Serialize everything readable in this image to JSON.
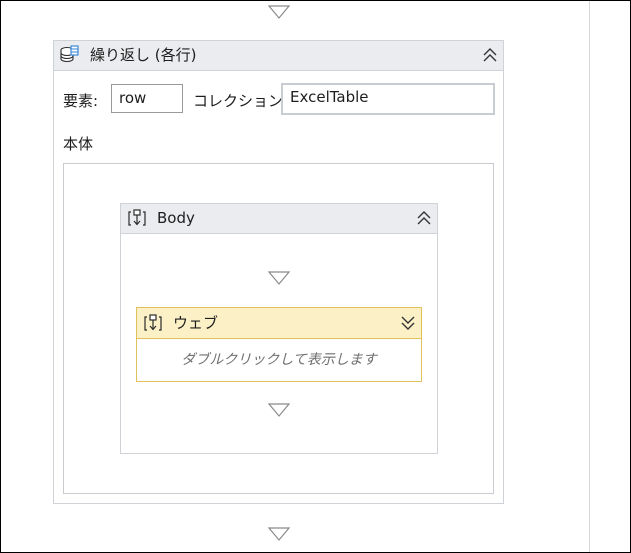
{
  "foreach": {
    "title": "繰り返し (各行)",
    "icon": "database-icon",
    "element_label": "要素:",
    "element_value": "row",
    "collection_label": "コレクション:",
    "collection_value": "ExcelTable",
    "body_label": "本体"
  },
  "body_sequence": {
    "title": "Body",
    "icon": "sequence-icon"
  },
  "web_activity": {
    "title": "ウェブ",
    "icon": "sequence-icon",
    "hint": "ダブルクリックして表示します"
  },
  "colors": {
    "header_bg": "#eaecef",
    "web_header_bg": "#fcf1c6",
    "web_border": "#e1c25a",
    "border": "#cfd3d8"
  }
}
